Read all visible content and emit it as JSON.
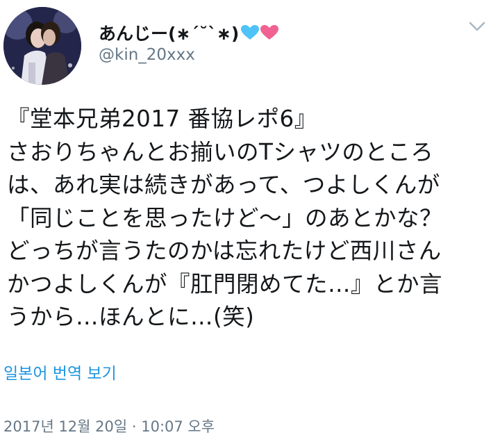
{
  "author": {
    "display_name": "あんじー(∗´˘`∗)",
    "handle": "@kin_20xxx",
    "badge_icons": [
      "blue-heart-icon",
      "pink-heart-icon"
    ]
  },
  "tweet": {
    "lines": [
      "『堂本兄弟2017 番協レポ6』",
      "さおりちゃんとお揃いのTシャツのところ",
      "は、あれ実は続きがあって、つよしくんが",
      "「同じことを思ったけど〜」のあとかな？",
      "どっちが言うたのかは忘れたけど西川さん",
      "かつよしくんが『肛門閉めてた…』とか言",
      "うから…ほんとに…(笑)"
    ],
    "translate_label": "일본어 번역 보기",
    "timestamp": "2017년 12월 20일 · 10:07 오후"
  },
  "colors": {
    "text": "#14171a",
    "secondary": "#657786",
    "link": "#1b95e0",
    "blue_heart": "#4fc3f7",
    "pink_heart": "#f06292"
  }
}
